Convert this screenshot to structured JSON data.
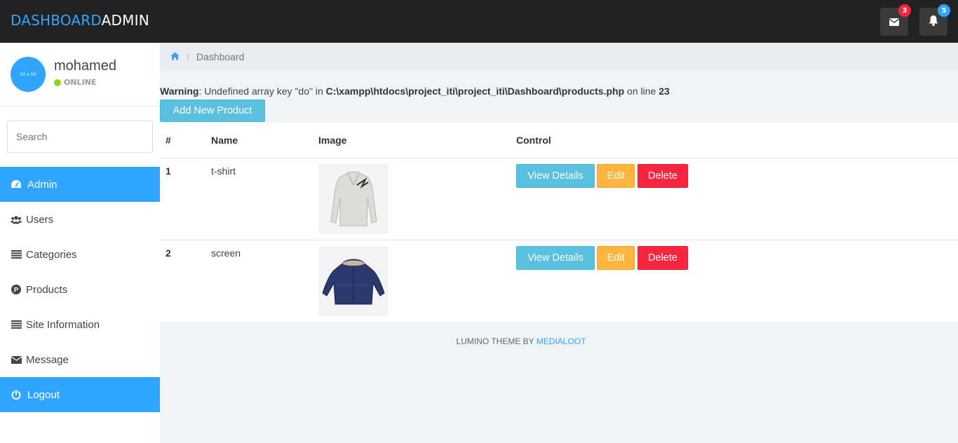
{
  "navbar": {
    "brand_part1": "DASHBOARD",
    "brand_part2": "ADMIN",
    "messages_badge": "3",
    "notifications_badge": "5"
  },
  "sidebar": {
    "avatar_text": "50 x 50",
    "username": "mohamed",
    "status": "ONLINE",
    "search_placeholder": "Search",
    "items": [
      {
        "label": "Admin",
        "icon": "dashboard-icon"
      },
      {
        "label": "Users",
        "icon": "users-icon"
      },
      {
        "label": "Categories",
        "icon": "list-icon"
      },
      {
        "label": "Products",
        "icon": "product-p-icon"
      },
      {
        "label": "Site Information",
        "icon": "list-icon"
      },
      {
        "label": "Message",
        "icon": "envelope-icon"
      },
      {
        "label": "Logout",
        "icon": "power-icon"
      }
    ]
  },
  "breadcrumb": {
    "current": "Dashboard"
  },
  "warning": {
    "label": "Warning",
    "text1": ": Undefined array key \"do\" in ",
    "path": "C:\\xampp\\htdocs\\project_iti\\project_iti\\Dashboard\\products.php",
    "text2": " on line ",
    "line": "23"
  },
  "add_button": "Add New Product",
  "table": {
    "headers": [
      "#",
      "Name",
      "Image",
      "Control"
    ],
    "rows": [
      {
        "num": "1",
        "name": "t-shirt",
        "image": "sweater-image"
      },
      {
        "num": "2",
        "name": "screen",
        "image": "jacket-image"
      }
    ],
    "view_label": "View Details",
    "edit_label": "Edit",
    "delete_label": "Delete"
  },
  "footer": {
    "text": "LUMINO THEME BY ",
    "link": "MEDIALOOT"
  },
  "colors": {
    "primary": "#30a5ff",
    "info": "#5bc0de",
    "warning": "#ffb53e",
    "danger": "#f9243f",
    "navbar": "#222222"
  }
}
